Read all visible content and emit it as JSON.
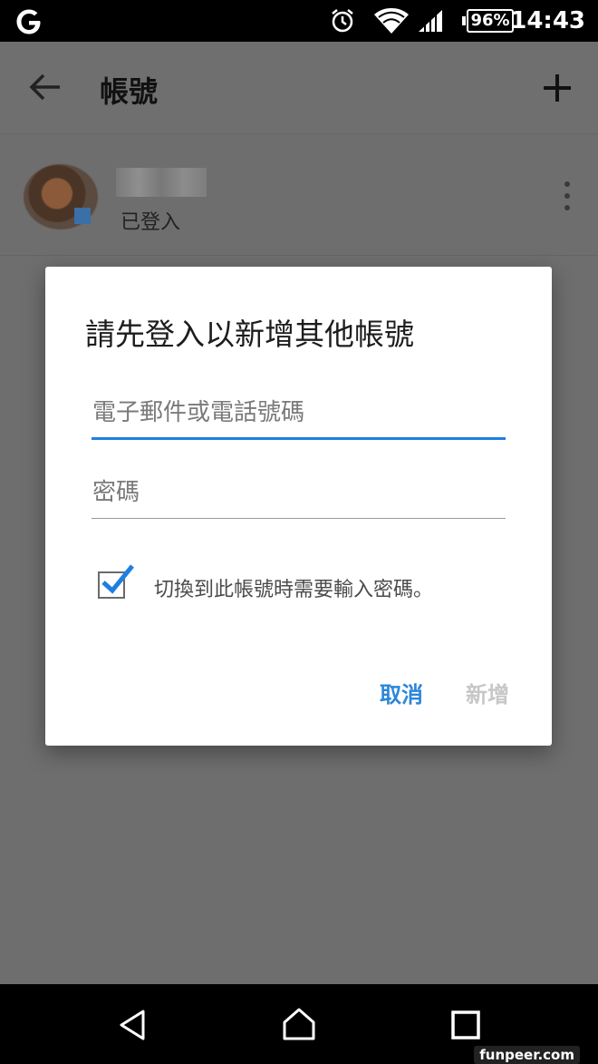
{
  "status_bar": {
    "battery": "96%",
    "time": "14:43"
  },
  "app_bar": {
    "title": "帳號"
  },
  "account": {
    "status": "已登入"
  },
  "dialog": {
    "title": "請先登入以新增其他帳號",
    "email_placeholder": "電子郵件或電話號碼",
    "password_placeholder": "密碼",
    "checkbox_label": "切換到此帳號時需要輸入密碼。",
    "checkbox_checked": true,
    "cancel_label": "取消",
    "add_label": "新增"
  },
  "watermark": "funpeer.com",
  "colors": {
    "accent": "#1e7fe0",
    "cancel": "#2b86d9",
    "disabled": "#c7c7c7",
    "scrim": "#6e6e6e"
  },
  "icons": [
    "google-icon",
    "alarm-icon",
    "wifi-icon",
    "signal-icon",
    "battery-icon",
    "back-arrow-icon",
    "plus-icon",
    "more-vert-icon",
    "checkmark-icon",
    "nav-back-icon",
    "nav-home-icon",
    "nav-recents-icon"
  ]
}
